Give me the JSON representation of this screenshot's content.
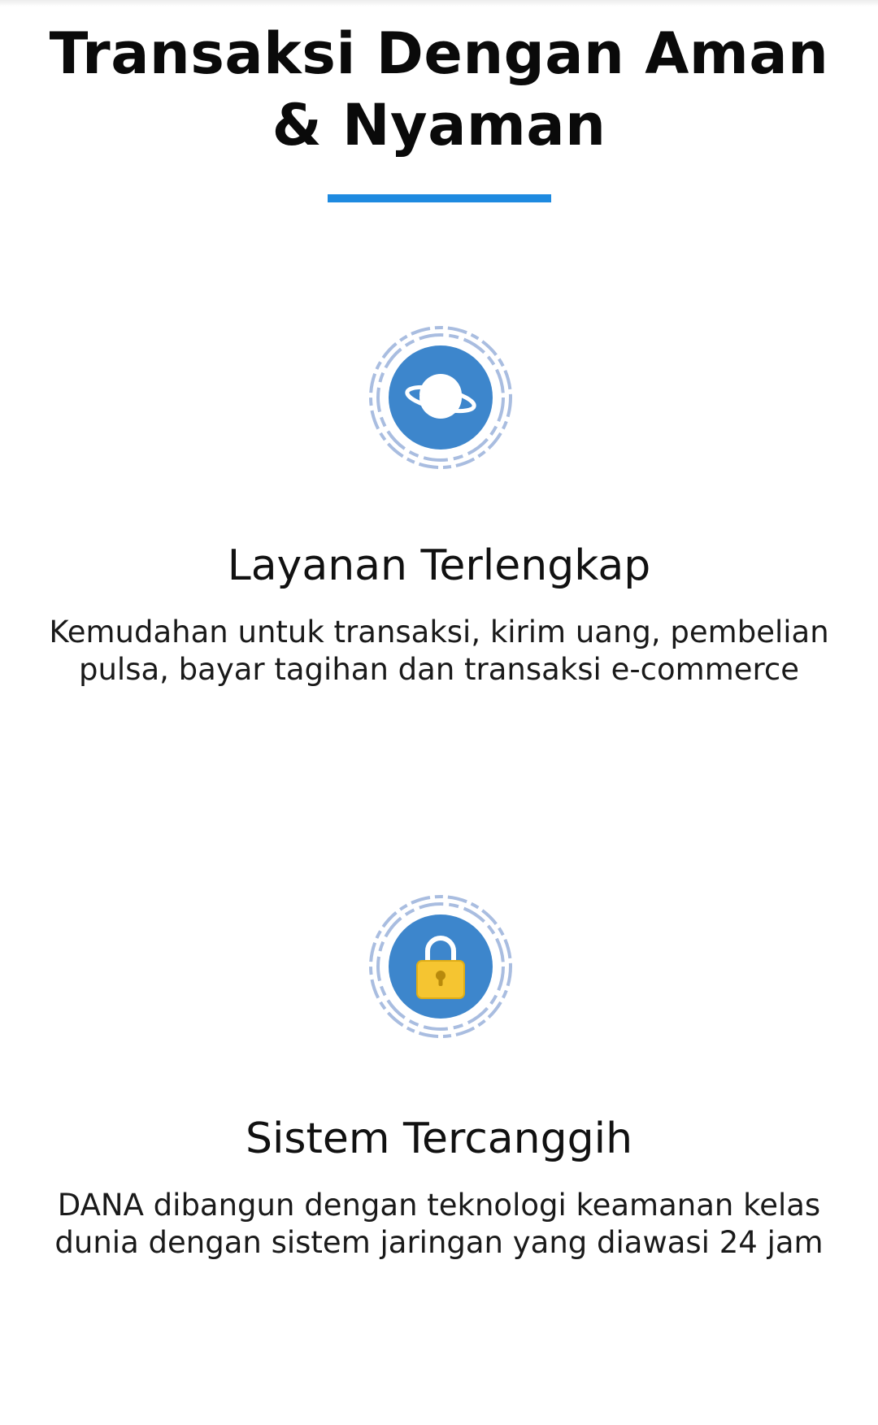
{
  "section": {
    "title": "Transaksi Dengan Aman & Nyaman"
  },
  "colors": {
    "accent": "#1e8ae0",
    "icon_blue": "#3d86cc",
    "ring": "#a9bde0",
    "lock": "#f5c531"
  },
  "features": [
    {
      "icon": "planet-icon",
      "title": "Layanan Terlengkap",
      "description": "Kemudahan untuk transaksi, kirim uang, pembelian pulsa, bayar tagihan dan transaksi e-commerce"
    },
    {
      "icon": "lock-icon",
      "title": "Sistem Tercanggih",
      "description": "DANA dibangun dengan teknologi keamanan kelas dunia dengan sistem jaringan yang diawasi 24 jam"
    }
  ]
}
